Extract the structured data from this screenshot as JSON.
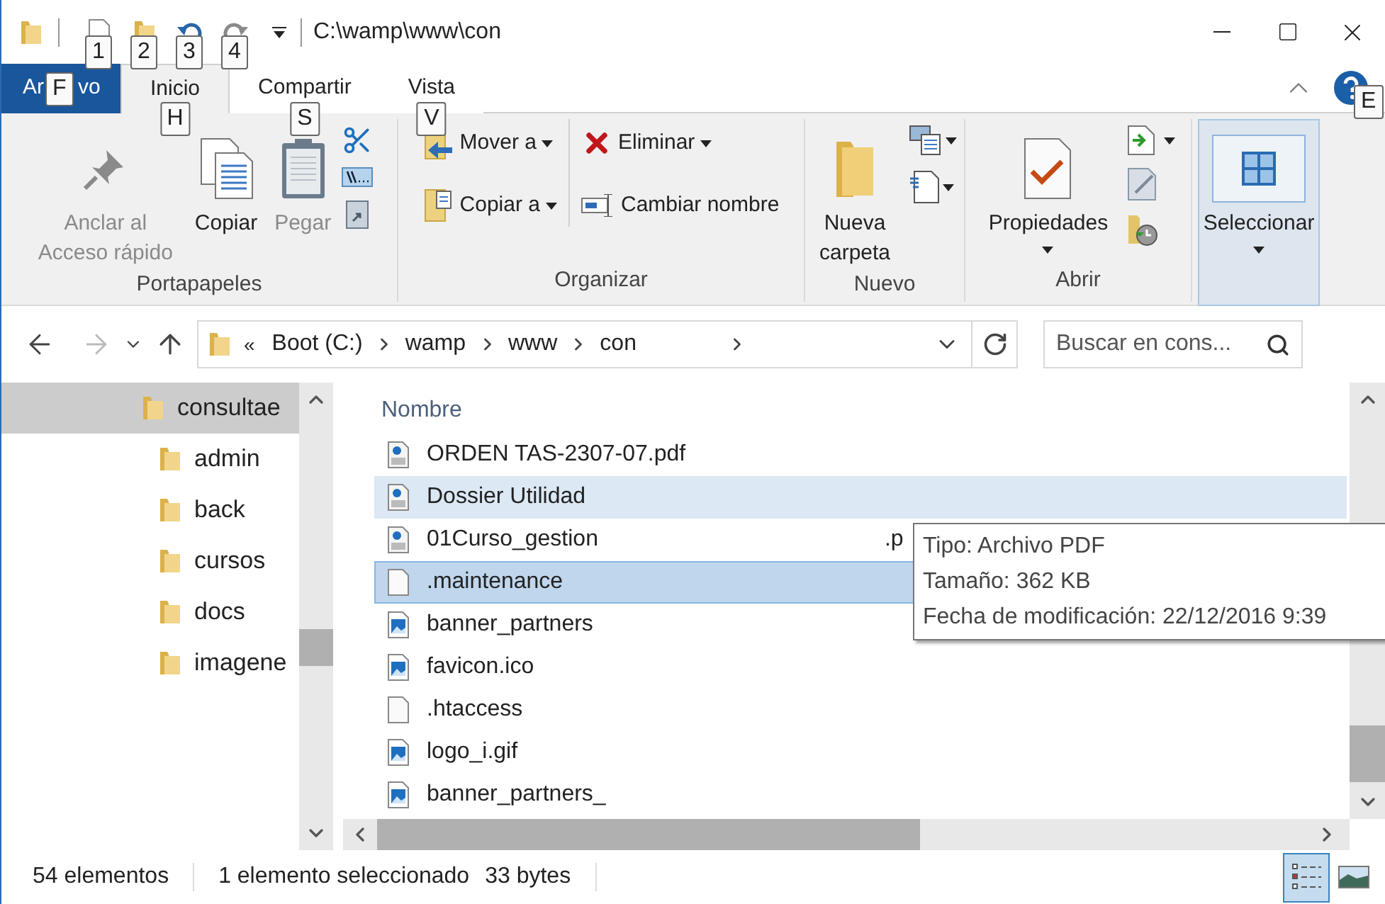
{
  "window": {
    "title": "C:\\wamp\\www\\con",
    "help_keytip": "E"
  },
  "quick_access": [
    {
      "keytip": "1",
      "disabled": false
    },
    {
      "keytip": "2",
      "disabled": false
    },
    {
      "keytip": "3",
      "disabled": false
    },
    {
      "keytip": "4",
      "disabled": true
    }
  ],
  "file_tab": {
    "label_start": "Ar",
    "keytip": "F",
    "label_end": "vo"
  },
  "tabs": [
    {
      "label": "Inicio",
      "keytip": "H",
      "selected": true
    },
    {
      "label": "Compartir",
      "keytip": "S",
      "selected": false
    },
    {
      "label": "Vista",
      "keytip": "V",
      "selected": false
    }
  ],
  "ribbon": [
    {
      "label": "Portapapeles",
      "items": [
        {
          "label": "Anclar al Acceso rápido",
          "disabled": true
        },
        {
          "label": "Copiar",
          "disabled": false
        },
        {
          "label": "Pegar",
          "disabled": true
        }
      ]
    },
    {
      "label": "Organizar",
      "items": [
        {
          "label": "Mover a",
          "dropdown": true
        },
        {
          "label": "Copiar a",
          "dropdown": true
        },
        {
          "label": "Eliminar",
          "dropdown": true
        },
        {
          "label": "Cambiar nombre",
          "dropdown": false
        }
      ]
    },
    {
      "label": "Nuevo",
      "items": [
        {
          "label": "Nueva carpeta"
        }
      ]
    },
    {
      "label": "Abrir",
      "items": [
        {
          "label": "Propiedades",
          "dropdown": true
        }
      ]
    },
    {
      "items": [
        {
          "label": "Seleccionar",
          "dropdown": true,
          "pressed": true
        }
      ]
    }
  ],
  "address": {
    "crumbs": [
      "Boot (C:)",
      "wamp",
      "www",
      "con"
    ],
    "overflow": "«"
  },
  "search": {
    "placeholder": "Buscar en cons..."
  },
  "tree": [
    {
      "label": "consultae",
      "selected": true,
      "children": [
        {
          "label": "admin",
          "selected": false
        },
        {
          "label": "back",
          "selected": false
        },
        {
          "label": "cursos",
          "selected": false
        },
        {
          "label": "docs",
          "selected": false
        },
        {
          "label": "imagene",
          "selected": false
        }
      ]
    }
  ],
  "files": {
    "column": "Nombre",
    "rows": [
      {
        "name": "ORDEN TAS-2307-07.pdf",
        "kind": "pdf",
        "selected": false,
        "hovered": false
      },
      {
        "name": "Dossier Utilidad",
        "kind": "pdf",
        "selected": false,
        "hovered": true
      },
      {
        "name": "01Curso_gestion",
        "tail": ".p",
        "kind": "pdf",
        "selected": false,
        "hovered": false
      },
      {
        "name": ".maintenance",
        "kind": "blank",
        "selected": true,
        "hovered": false
      },
      {
        "name": "banner_partners",
        "kind": "image",
        "selected": false,
        "hovered": false
      },
      {
        "name": "favicon.ico",
        "kind": "image",
        "selected": false,
        "hovered": false
      },
      {
        "name": ".htaccess",
        "kind": "blank",
        "selected": false,
        "hovered": false
      },
      {
        "name": "logo_i.gif",
        "kind": "image",
        "selected": false,
        "hovered": false
      },
      {
        "name": "banner_partners_",
        "kind": "image",
        "selected": false,
        "hovered": false
      }
    ]
  },
  "tooltip": [
    "Tipo: Archivo PDF",
    "Tamaño: 362 KB",
    "Fecha de modificación: 22/12/2016 9:39"
  ],
  "status": {
    "count": "54 elementos",
    "selection": "1 elemento seleccionado",
    "size": "33 bytes",
    "views": [
      {
        "kind": "details",
        "selected": true
      },
      {
        "kind": "large",
        "selected": false
      }
    ]
  }
}
